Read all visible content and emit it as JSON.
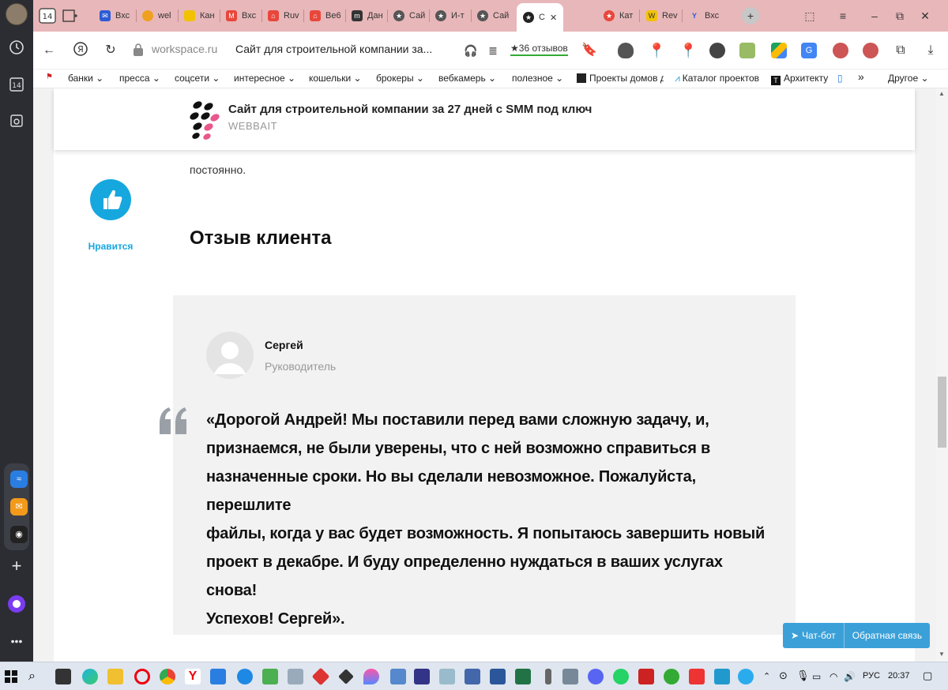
{
  "browser": {
    "tab_count_badge": "14",
    "tabs": [
      {
        "label": "Вхс",
        "color": "#2d5bd6"
      },
      {
        "label": "wel",
        "color": "#f0a020"
      },
      {
        "label": "Кан",
        "color": "#f2c200"
      },
      {
        "label": "Вхс",
        "color": "#e8473c"
      },
      {
        "label": "Ruv",
        "color": "#e8473c"
      },
      {
        "label": "Ве6",
        "color": "#e8473c"
      },
      {
        "label": "Дан",
        "color": "#333333"
      },
      {
        "label": "Сай",
        "color": "#555555"
      },
      {
        "label": "И-т",
        "color": "#555555"
      },
      {
        "label": "Сай",
        "color": "#555555"
      },
      {
        "label": "С",
        "color": "#222222"
      },
      {
        "label": "Кат",
        "color": "#e8473c"
      },
      {
        "label": "Rev",
        "color": "#f2c200"
      },
      {
        "label": "Вхс",
        "color": "#2d5bd6"
      }
    ],
    "active_tab_close": "✕",
    "address": {
      "host": "workspace.ru",
      "title": "Сайт для строительной компании за...",
      "reviews": "36 отзывов"
    },
    "bookmarks": [
      "банки ⌄",
      "пресса ⌄",
      "соцсети ⌄",
      "интересное ⌄",
      "кошельки ⌄",
      "брокеры ⌄",
      "вебкамерь ⌄",
      "полезное ⌄",
      "Проекты домов д",
      "Каталог проектов",
      "Архитекту"
    ],
    "bookmarks_more": "»",
    "bookmarks_other": "Другое ⌄"
  },
  "page": {
    "sticky_title": "Сайт для строительной компании за 27 дней с SMM под ключ",
    "sticky_sub": "WEBBAIT",
    "prev_text": "постоянно.",
    "like_label": "Нравится",
    "section_title": "Отзыв клиента",
    "review": {
      "name": "Сергей",
      "role": "Руководитель",
      "text_lines": [
        "«Дорогой Андрей! Мы поставили перед вами сложную задачу, и,",
        "признаемся, не были уверены, что с ней возможно справиться в",
        "назначенные сроки. Но вы сделали невозможное. Пожалуйста, перешлите",
        "файлы, когда у вас будет возможность. Я попытаюсь завершить новый",
        "проект в декабре. И буду определенно нуждаться в ваших услугах снова!",
        "Успехов! Сергей»."
      ]
    },
    "chat_bot": "Чат-бот",
    "feedback": "Обратная связь"
  },
  "taskbar": {
    "lang": "РУС",
    "time": "20:37"
  },
  "colors": {
    "tabbar": "#e8b7b9",
    "accent": "#16a7df",
    "chat": "#3ba0d8"
  }
}
